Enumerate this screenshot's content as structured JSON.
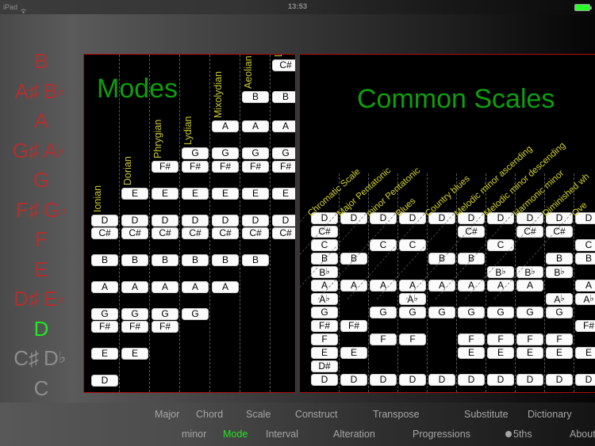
{
  "status_bar": {
    "carrier": "iPad",
    "wifi_icon": "wifi-icon",
    "time": "13:53",
    "battery_icon": "battery-full-icon"
  },
  "note_rail": {
    "selected": "D",
    "rows": [
      {
        "sharp": "",
        "natural": "B",
        "flat": "",
        "state": "normal"
      },
      {
        "sharp": "A♯",
        "natural": "",
        "flat": "B♭",
        "state": "normal"
      },
      {
        "sharp": "",
        "natural": "A",
        "flat": "",
        "state": "normal"
      },
      {
        "sharp": "G♯",
        "natural": "",
        "flat": "A♭",
        "state": "normal"
      },
      {
        "sharp": "",
        "natural": "G",
        "flat": "",
        "state": "normal"
      },
      {
        "sharp": "F♯",
        "natural": "",
        "flat": "G♭",
        "state": "normal"
      },
      {
        "sharp": "",
        "natural": "F",
        "flat": "",
        "state": "normal"
      },
      {
        "sharp": "",
        "natural": "E",
        "flat": "",
        "state": "normal"
      },
      {
        "sharp": "D♯",
        "natural": "",
        "flat": "E♭",
        "state": "normal"
      },
      {
        "sharp": "",
        "natural": "D",
        "flat": "",
        "state": "selected"
      },
      {
        "sharp": "C♯",
        "natural": "",
        "flat": "D♭",
        "state": "dim"
      },
      {
        "sharp": "",
        "natural": "C",
        "flat": "",
        "state": "dim"
      }
    ]
  },
  "modes_panel": {
    "title": "Modes",
    "root": "D",
    "columns": [
      {
        "label": "Ionian",
        "notes": [
          "D",
          "C#",
          "B",
          "A",
          "G",
          "F#",
          "E",
          "D"
        ]
      },
      {
        "label": "Dorian",
        "notes": [
          "D",
          "C#",
          "B",
          "A",
          "G",
          "F#",
          "E",
          "D"
        ]
      },
      {
        "label": "Phrygian",
        "notes": [
          "D",
          "C#",
          "B",
          "A",
          "G",
          "F#",
          "E"
        ]
      },
      {
        "label": "Lydian",
        "notes": [
          "D",
          "C#",
          "B",
          "A",
          "G",
          "F#",
          "E"
        ]
      },
      {
        "label": "Mixolydian",
        "notes": [
          "D",
          "C#",
          "B",
          "A",
          "G",
          "F#",
          "E"
        ]
      },
      {
        "label": "Aeolian",
        "notes": [
          "D",
          "C#",
          "B",
          "A",
          "G",
          "F#",
          "E"
        ]
      },
      {
        "label": "Locrian",
        "notes": [
          "D",
          "C#",
          "B",
          "A",
          "G",
          "F#",
          "E"
        ]
      }
    ],
    "grid_rows": [
      "C#",
      "B",
      "A",
      "G",
      "F#",
      "E",
      "D",
      "C#",
      "B",
      "A",
      "G",
      "F#",
      "E",
      "D"
    ],
    "cells": [
      [
        "",
        "",
        "",
        "",
        "",
        "",
        "C#"
      ],
      [
        "",
        "",
        "",
        "",
        "",
        "B",
        "B"
      ],
      [
        "",
        "",
        "",
        "",
        "A",
        "A",
        "A"
      ],
      [
        "",
        "",
        "",
        "G",
        "G",
        "G",
        "G"
      ],
      [
        "",
        "",
        "F#",
        "F#",
        "F#",
        "F#",
        "F#"
      ],
      [
        "",
        "E",
        "E",
        "E",
        "E",
        "E",
        "E"
      ],
      [
        "D",
        "D",
        "D",
        "D",
        "D",
        "D",
        "D"
      ],
      [
        "C#",
        "C#",
        "C#",
        "C#",
        "C#",
        "C#",
        "C#"
      ],
      [
        "B",
        "B",
        "B",
        "B",
        "B",
        "B",
        ""
      ],
      [
        "A",
        "A",
        "A",
        "A",
        "A",
        "",
        ""
      ],
      [
        "G",
        "G",
        "G",
        "G",
        "",
        "",
        ""
      ],
      [
        "F#",
        "F#",
        "F#",
        "",
        "",
        "",
        ""
      ],
      [
        "E",
        "E",
        "",
        "",
        "",
        "",
        ""
      ],
      [
        "D",
        "",
        "",
        "",
        "",
        "",
        ""
      ]
    ]
  },
  "scales_panel": {
    "title": "Common Scales",
    "columns": [
      "Chromatic Scale",
      "Major Pentatonic",
      "minor Pentatonic",
      "Blues",
      "Country blues",
      "Melodic minor ascending",
      "Melodic minor descending",
      "Harmonic minor",
      "Diminished wh",
      "Ove"
    ],
    "grid_rows": [
      "D",
      "C#",
      "C",
      "B",
      "B♭",
      "A",
      "A♭",
      "G",
      "F#",
      "F",
      "E",
      "D#",
      "D"
    ],
    "cells": [
      [
        "D",
        "D",
        "D",
        "D",
        "D",
        "D",
        "D",
        "D",
        "D",
        "D"
      ],
      [
        "C#",
        "",
        "",
        "",
        "",
        "C#",
        "",
        "C#",
        "C#",
        ""
      ],
      [
        "C",
        "",
        "C",
        "C",
        "",
        "",
        "C",
        "",
        "",
        "C"
      ],
      [
        "B",
        "B",
        "",
        "",
        "B",
        "B",
        "",
        "",
        "B",
        "B"
      ],
      [
        "B♭",
        "",
        "",
        "",
        "",
        "",
        "B♭",
        "B♭",
        "B♭",
        ""
      ],
      [
        "A",
        "A",
        "A",
        "A",
        "A",
        "A",
        "A",
        "A",
        "",
        "A"
      ],
      [
        "A♭",
        "",
        "",
        "A♭",
        "",
        "",
        "",
        "",
        "A♭",
        "A♭"
      ],
      [
        "G",
        "",
        "G",
        "G",
        "G",
        "G",
        "G",
        "G",
        "G",
        ""
      ],
      [
        "F#",
        "F#",
        "",
        "",
        "",
        "",
        "",
        "",
        "",
        "F#"
      ],
      [
        "F",
        "",
        "F",
        "F",
        "",
        "F",
        "F",
        "F",
        "F",
        ""
      ],
      [
        "E",
        "E",
        "",
        "",
        "",
        "E",
        "E",
        "E",
        "E",
        "E"
      ],
      [
        "D#",
        "",
        "",
        "",
        "",
        "",
        "",
        "",
        "",
        ""
      ],
      [
        "D",
        "D",
        "D",
        "D",
        "D",
        "D",
        "D",
        "D",
        "D",
        "D"
      ]
    ]
  },
  "toolbar": {
    "row1": [
      {
        "label": "Major",
        "active": false
      },
      {
        "label": "Chord",
        "active": false
      },
      {
        "label": "Scale",
        "active": false
      },
      {
        "label": "Construct",
        "active": false
      },
      {
        "label": "Transpose",
        "active": false
      },
      {
        "label": "Substitute",
        "active": false
      },
      {
        "label": "Dictionary",
        "active": false
      }
    ],
    "row2": [
      {
        "label": "minor",
        "active": false
      },
      {
        "label": "Mode",
        "active": true
      },
      {
        "label": "Interval",
        "active": false
      },
      {
        "label": "Alteration",
        "active": false
      },
      {
        "label": "Progressions",
        "active": false
      },
      {
        "label": "5ths",
        "active": false
      },
      {
        "label": "About",
        "active": false
      }
    ]
  },
  "colors": {
    "accent_green": "#22e622",
    "note_red": "#b03030",
    "panel_border": "#b00d0d",
    "label_yellow": "#d4d42a",
    "cell_bg": "#fbfbfb"
  }
}
